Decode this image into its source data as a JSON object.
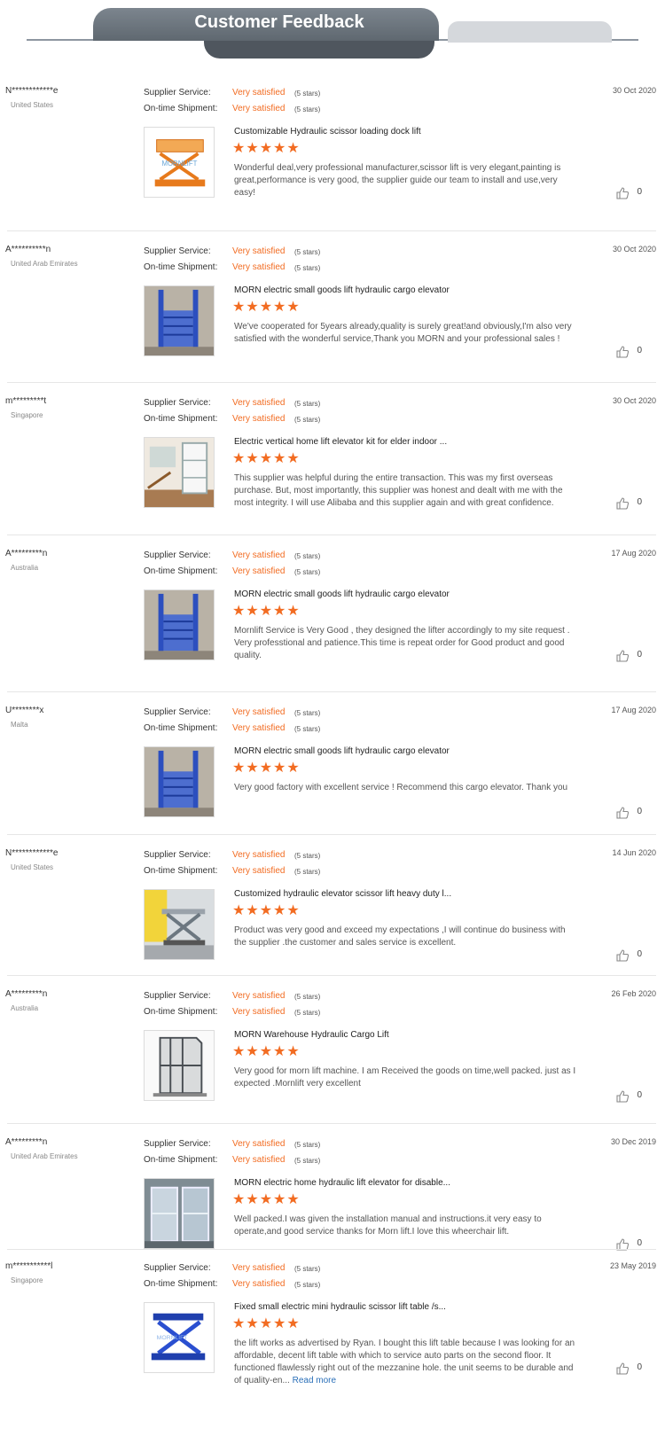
{
  "header": {
    "title": "Customer Feedback"
  },
  "labels": {
    "supplier_service": "Supplier Service:",
    "ontime_shipment": "On-time Shipment:"
  },
  "colors": {
    "accent": "#f26c22",
    "link": "#2a6fb8",
    "header_tab": "#6b747c"
  },
  "reviews": [
    {
      "user": "N************e",
      "country": "United States",
      "date": "30 Oct 2020",
      "supplier": "Very satisfied",
      "supplier_stars": "(5 stars)",
      "shipment": "Very satisfied",
      "shipment_stars": "(5 stars)",
      "product": "Customizable Hydraulic scissor loading dock lift",
      "rating": 5,
      "stars_text": "★★★★★",
      "comment": "Wonderful deal,very professional manufacturer,scissor lift is very elegant,painting is great,performance is very good, the supplier guide our team to install and use,very easy!",
      "likes": "0",
      "thumb_icon": "scissor-lift-image"
    },
    {
      "user": "A**********n",
      "country": "United Arab Emirates",
      "date": "30 Oct 2020",
      "supplier": "Very satisfied",
      "supplier_stars": "(5 stars)",
      "shipment": "Very satisfied",
      "shipment_stars": "(5 stars)",
      "product": "MORN electric small goods lift hydraulic cargo elevator",
      "rating": 5,
      "stars_text": "★★★★★",
      "comment": "We've cooperated for 5years already,quality is surely great!and obviously,I'm also very satisfied with the wonderful service,Thank you MORN and your professional sales !",
      "likes": "0",
      "thumb_icon": "cargo-lift-image"
    },
    {
      "user": "m*********t",
      "country": "Singapore",
      "date": "30 Oct 2020",
      "supplier": "Very satisfied",
      "supplier_stars": "(5 stars)",
      "shipment": "Very satisfied",
      "shipment_stars": "(5 stars)",
      "product": "Electric vertical home lift elevator kit for elder indoor ...",
      "rating": 5,
      "stars_text": "★★★★★",
      "comment": "This supplier was helpful during the entire transaction. This was my first overseas purchase. But, most importantly, this supplier was honest and dealt with me with the most integrity. I will use Alibaba and this supplier again and with great confidence.",
      "likes": "0",
      "thumb_icon": "home-elevator-image"
    },
    {
      "user": "A*********n",
      "country": "Australia",
      "date": "17 Aug 2020",
      "supplier": "Very satisfied",
      "supplier_stars": "(5 stars)",
      "shipment": "Very satisfied",
      "shipment_stars": "(5 stars)",
      "product": "MORN electric small goods lift hydraulic cargo elevator",
      "rating": 5,
      "stars_text": "★★★★★",
      "comment": "Mornlift Service is Very Good , they designed the lifter accordingly to my site request . Very professtional and patience.This time is repeat order for Good product and good quality.",
      "likes": "0",
      "thumb_icon": "cargo-lift-image"
    },
    {
      "user": "U********x",
      "country": "Malta",
      "date": "17 Aug 2020",
      "supplier": "Very satisfied",
      "supplier_stars": "(5 stars)",
      "shipment": "Very satisfied",
      "shipment_stars": "(5 stars)",
      "product": "MORN electric small goods lift hydraulic cargo elevator",
      "rating": 5,
      "stars_text": "★★★★★",
      "comment": "Very good factory with excellent service ! Recommend this cargo elevator. Thank you",
      "likes": "0",
      "thumb_icon": "cargo-lift-image"
    },
    {
      "user": "N************e",
      "country": "United States",
      "date": "14 Jun 2020",
      "supplier": "Very satisfied",
      "supplier_stars": "(5 stars)",
      "shipment": "Very satisfied",
      "shipment_stars": "(5 stars)",
      "product": "Customized hydraulic elevator scissor lift heavy duty l...",
      "rating": 5,
      "stars_text": "★★★★★",
      "comment": "Product was very good and exceed my expectations ,I will continue do business with the supplier .the customer and sales service is excellent.",
      "likes": "0",
      "thumb_icon": "heavy-scissor-lift-image"
    },
    {
      "user": "A*********n",
      "country": "Australia",
      "date": "26 Feb 2020",
      "supplier": "Very satisfied",
      "supplier_stars": "(5 stars)",
      "shipment": "Very satisfied",
      "shipment_stars": "(5 stars)",
      "product": "MORN Warehouse Hydraulic Cargo Lift",
      "rating": 5,
      "stars_text": "★★★★★",
      "comment": "Very good for morn lift machine. I am Received the goods on time,well packed. just as I expected .Mornlift very excellent",
      "likes": "0",
      "thumb_icon": "warehouse-lift-image"
    },
    {
      "user": "A*********n",
      "country": "United Arab Emirates",
      "date": "30 Dec 2019",
      "supplier": "Very satisfied",
      "supplier_stars": "(5 stars)",
      "shipment": "Very satisfied",
      "shipment_stars": "(5 stars)",
      "product": "MORN electric home hydraulic lift elevator for disable...",
      "rating": 5,
      "stars_text": "★★★★★",
      "comment": "Well packed.I was given the installation manual and instructions.it very easy to operate,and good service thanks for Morn lift.I love this wheerchair lift.",
      "likes": "0",
      "thumb_icon": "wheelchair-lift-image"
    },
    {
      "user": "m***********l",
      "country": "Singapore",
      "date": "23 May 2019",
      "supplier": "Very satisfied",
      "supplier_stars": "(5 stars)",
      "shipment": "Very satisfied",
      "shipment_stars": "(5 stars)",
      "product": "Fixed small electric mini hydraulic scissor lift table /s...",
      "rating": 5,
      "stars_text": "★★★★★",
      "comment": "the lift works as advertised by Ryan. I bought this lift table because I was looking for an affordable, decent lift table with which to service auto parts on the second floor. It functioned flawlessly right out of the mezzanine hole. the unit seems to be durable and of quality-en...",
      "read_more": "Read more",
      "likes": "0",
      "thumb_icon": "mini-scissor-table-image"
    }
  ]
}
